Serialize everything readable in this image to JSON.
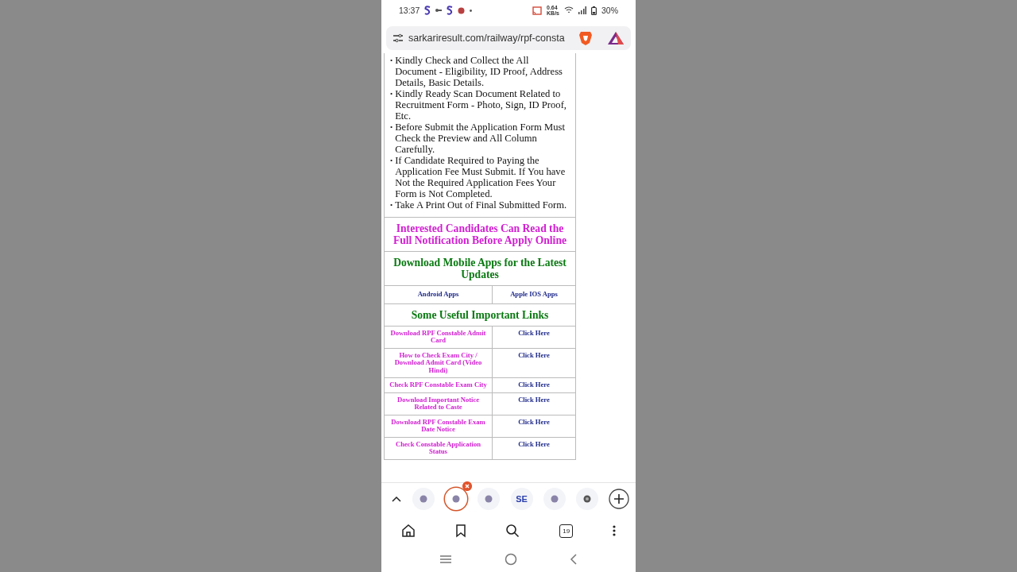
{
  "status_bar": {
    "time": "13:37",
    "speed_value": "0.64",
    "speed_unit": "KB/s",
    "battery": "30%"
  },
  "url_bar": {
    "url": "sarkariresult.com/railway/rpf-consta"
  },
  "bullet": "•",
  "instructions": [
    "Kindly Check and Collect the All Document - Eligibility, ID Proof, Address Details, Basic Details.",
    "Kindly Ready Scan Document Related to Recruitment Form - Photo, Sign, ID Proof, Etc.",
    "Before Submit the Application Form Must Check the Preview and All Column Carefully.",
    "If Candidate Required to Paying the Application Fee Must Submit. If You have Not the Required Application Fees Your Form is Not Completed.",
    "Take A Print Out of Final Submitted Form."
  ],
  "notice": "Interested Candidates Can Read the Full Notification Before Apply Online",
  "apps_heading": "Download Mobile Apps for the Latest Updates",
  "apps": [
    "Android Apps",
    "Apple IOS Apps"
  ],
  "links_heading": "Some Useful Important Links",
  "links": [
    {
      "label": "Download RPF Constable Admit Card",
      "action": "Click Here"
    },
    {
      "label": "How to Check Exam City / Download Admit Card (Video Hindi)",
      "action": "Click Here"
    },
    {
      "label": "Check RPF Constable Exam City",
      "action": "Click Here"
    },
    {
      "label": "Download Important Notice Related to Caste",
      "action": "Click Here"
    },
    {
      "label": "Download RPF Constable Exam Date Notice",
      "action": "Click Here"
    },
    {
      "label": "Check Constable Application Status",
      "action": "Click Here"
    }
  ],
  "tabs": [
    {
      "kind": "favicon",
      "selected": false
    },
    {
      "kind": "favicon",
      "selected": true
    },
    {
      "kind": "favicon",
      "selected": false
    },
    {
      "kind": "text",
      "label": "SE",
      "selected": false
    },
    {
      "kind": "favicon",
      "selected": false
    },
    {
      "kind": "dark",
      "selected": false
    }
  ],
  "tab_count": "19"
}
